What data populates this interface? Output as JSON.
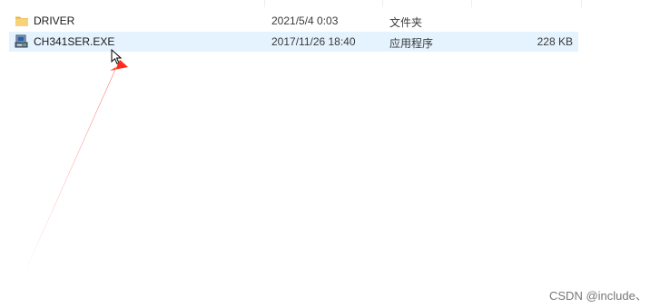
{
  "files": [
    {
      "name": "DRIVER",
      "date": "2021/5/4 0:03",
      "type": "文件夹",
      "size": "",
      "icon": "folder-icon",
      "selected": false
    },
    {
      "name": "CH341SER.EXE",
      "date": "2017/11/26 18:40",
      "type": "应用程序",
      "size": "228 KB",
      "icon": "installer-exe-icon",
      "selected": true
    }
  ],
  "watermark": "CSDN @include、",
  "colors": {
    "selection": "#e5f3ff",
    "annotation_arrow": "#ff2a1a",
    "folder": "#f2c55c"
  }
}
